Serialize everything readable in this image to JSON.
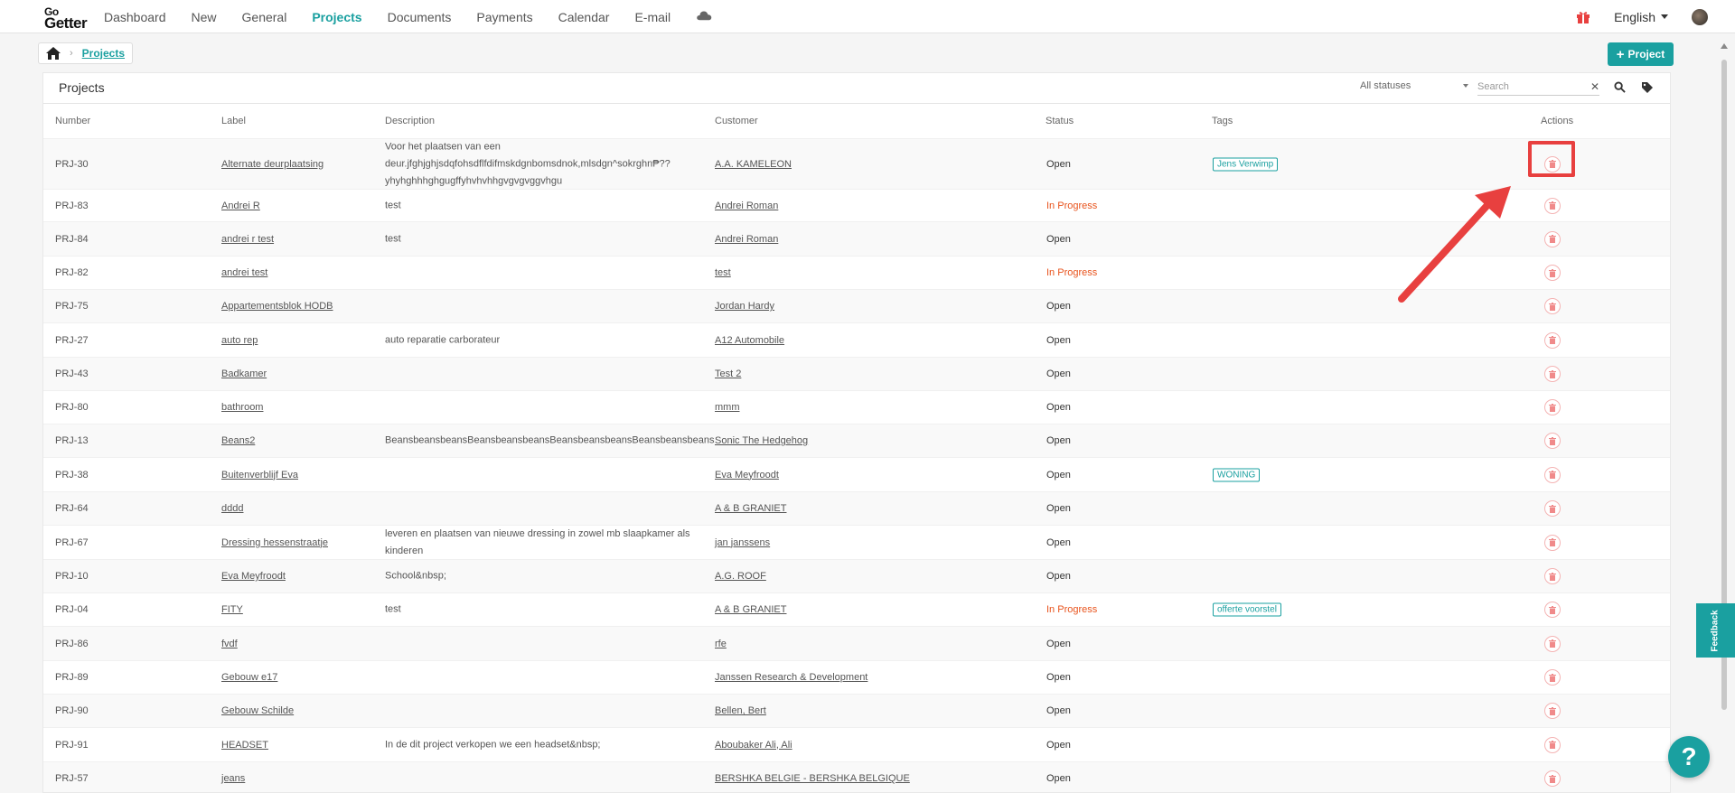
{
  "nav": {
    "logo_go": "Go",
    "logo_getter": "Getter",
    "items": [
      {
        "label": "Dashboard",
        "active": false
      },
      {
        "label": "New",
        "active": false
      },
      {
        "label": "General",
        "active": false
      },
      {
        "label": "Projects",
        "active": true
      },
      {
        "label": "Documents",
        "active": false
      },
      {
        "label": "Payments",
        "active": false
      },
      {
        "label": "Calendar",
        "active": false
      },
      {
        "label": "E-mail",
        "active": false
      }
    ],
    "language": "English"
  },
  "breadcrumb": {
    "current": "Projects"
  },
  "add_project_label": "Project",
  "panel": {
    "title": "Projects",
    "status_filter": "All statuses",
    "search_placeholder": "Search"
  },
  "table": {
    "headers": {
      "number": "Number",
      "label": "Label",
      "description": "Description",
      "customer": "Customer",
      "status": "Status",
      "tags": "Tags",
      "actions": "Actions"
    },
    "rows": [
      {
        "number": "PRJ-30",
        "label": "Alternate deurplaatsing",
        "description": "Voor het plaatsen van een deur.jfghjghjsdqfohsdflfdifmskdgnbomsdnok,mlsdgn^sokrghn₱?? yhyhghhhghgugffyhvhvhhgvgvgvggvhgu",
        "customer": "A.A. KAMELEON",
        "status": "Open",
        "tag": "Jens Verwimp"
      },
      {
        "number": "PRJ-83",
        "label": "Andrei R",
        "description": "test",
        "customer": "Andrei Roman",
        "status": "In Progress",
        "tag": ""
      },
      {
        "number": "PRJ-84",
        "label": "andrei r test",
        "description": "test",
        "customer": "Andrei Roman",
        "status": "Open",
        "tag": ""
      },
      {
        "number": "PRJ-82",
        "label": "andrei test",
        "description": "",
        "customer": "test",
        "status": "In Progress",
        "tag": ""
      },
      {
        "number": "PRJ-75",
        "label": "Appartementsblok HODB",
        "description": "",
        "customer": "Jordan Hardy",
        "status": "Open",
        "tag": ""
      },
      {
        "number": "PRJ-27",
        "label": "auto rep",
        "description": "auto reparatie carborateur",
        "customer": "A12 Automobile",
        "status": "Open",
        "tag": ""
      },
      {
        "number": "PRJ-43",
        "label": "Badkamer",
        "description": "",
        "customer": "Test 2",
        "status": "Open",
        "tag": ""
      },
      {
        "number": "PRJ-80",
        "label": "bathroom",
        "description": "",
        "customer": "mmm",
        "status": "Open",
        "tag": ""
      },
      {
        "number": "PRJ-13",
        "label": "Beans2",
        "description": "BeansbeansbeansBeansbeansbeansBeansbeansbeansBeansbeansbeans",
        "customer": "Sonic The Hedgehog",
        "status": "Open",
        "tag": ""
      },
      {
        "number": "PRJ-38",
        "label": "Buitenverblijf Eva",
        "description": "",
        "customer": "Eva Meyfroodt",
        "status": "Open",
        "tag": "WONING"
      },
      {
        "number": "PRJ-64",
        "label": "dddd",
        "description": "",
        "customer": "A & B GRANIET",
        "status": "Open",
        "tag": ""
      },
      {
        "number": "PRJ-67",
        "label": "Dressing hessenstraatje",
        "description": "leveren en plaatsen van nieuwe dressing in zowel mb slaapkamer als kinderen",
        "customer": "jan janssens",
        "status": "Open",
        "tag": ""
      },
      {
        "number": "PRJ-10",
        "label": "Eva Meyfroodt",
        "description": "School&nbsp;",
        "customer": "A.G. ROOF",
        "status": "Open",
        "tag": ""
      },
      {
        "number": "PRJ-04",
        "label": "FITY",
        "description": "test",
        "customer": "A & B GRANIET",
        "status": "In Progress",
        "tag": "offerte voorstel"
      },
      {
        "number": "PRJ-86",
        "label": "fvdf",
        "description": "",
        "customer": "rfe",
        "status": "Open",
        "tag": ""
      },
      {
        "number": "PRJ-89",
        "label": "Gebouw e17",
        "description": "",
        "customer": "Janssen Research & Development",
        "status": "Open",
        "tag": ""
      },
      {
        "number": "PRJ-90",
        "label": "Gebouw Schilde",
        "description": "",
        "customer": "Bellen, Bert",
        "status": "Open",
        "tag": ""
      },
      {
        "number": "PRJ-91",
        "label": "HEADSET",
        "description": "In de dit project verkopen we een headset&nbsp;",
        "customer": "Aboubaker Ali, Ali",
        "status": "Open",
        "tag": ""
      },
      {
        "number": "PRJ-57",
        "label": "jeans",
        "description": "",
        "customer": "BERSHKA BELGIE - BERSHKA BELGIQUE",
        "status": "Open",
        "tag": ""
      }
    ]
  },
  "feedback_label": "Feedback",
  "help_label": "?",
  "colors": {
    "accent": "#1aa0a0",
    "in_progress": "#e8531c",
    "highlight": "#e8403f"
  }
}
